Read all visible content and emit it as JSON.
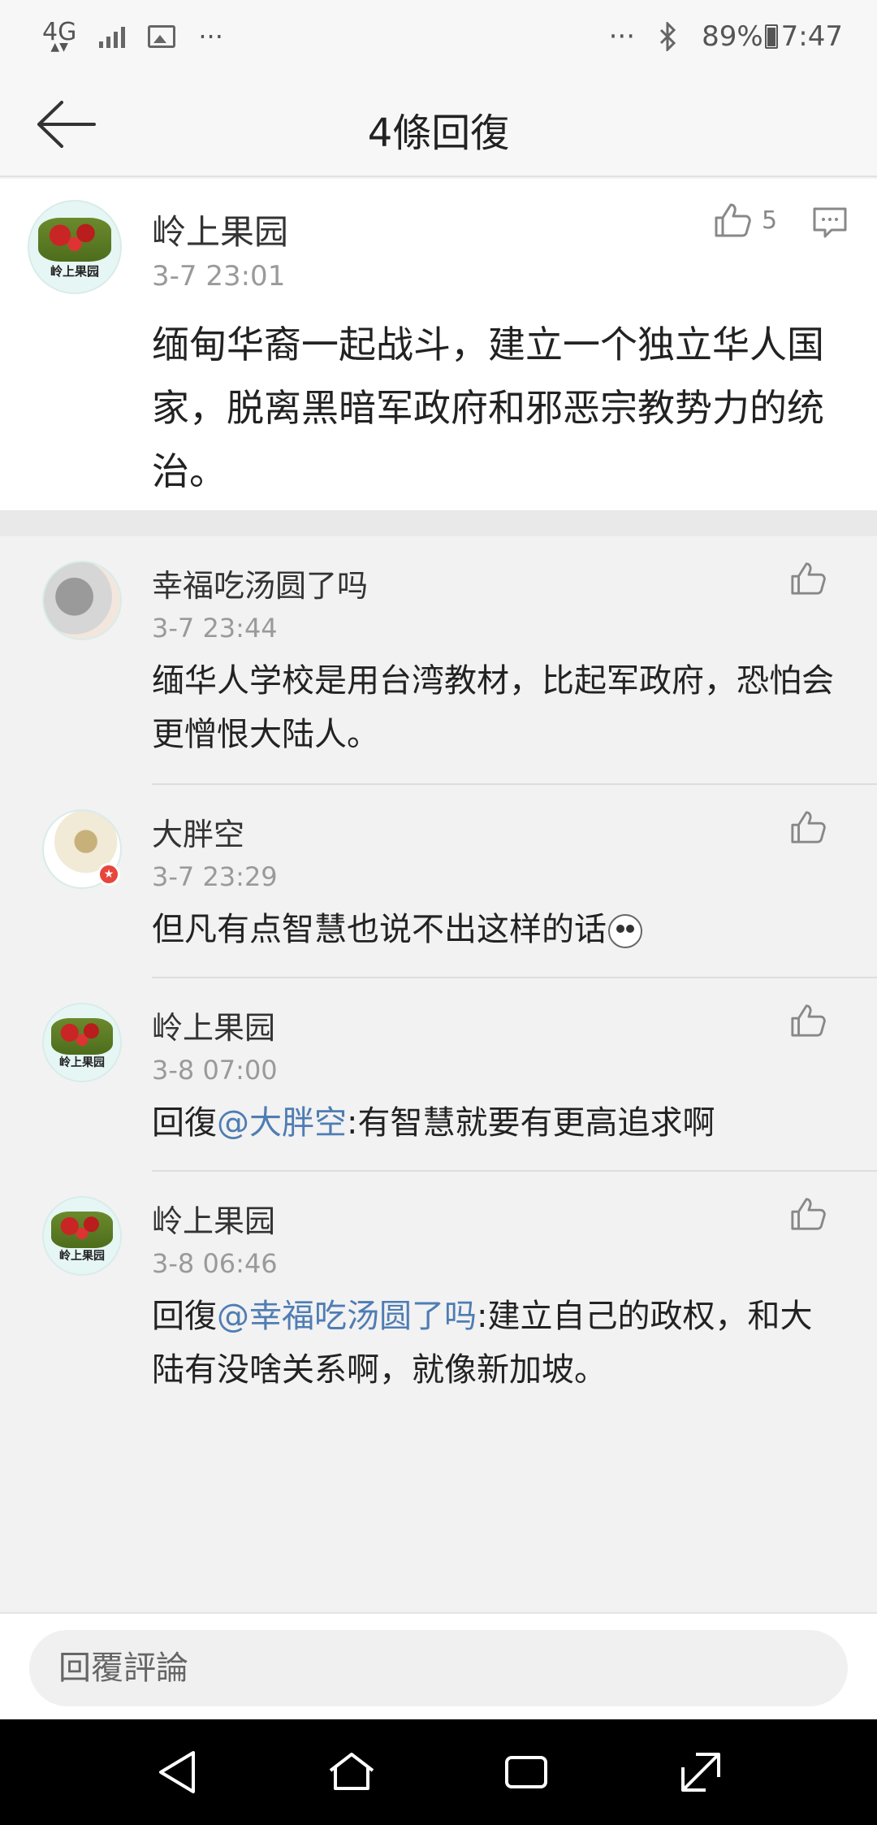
{
  "status_bar": {
    "network": "4G",
    "more": "···",
    "more_right": "···",
    "battery": "89%",
    "time": "7:47"
  },
  "header": {
    "title": "4條回復"
  },
  "main_comment": {
    "user": "岭上果园",
    "avatar_caption": "岭上果园",
    "time": "3-7 23:01",
    "like_count": "5",
    "text": "缅甸华裔一起战斗，建立一个独立华人国家，脱离黑暗军政府和邪恶宗教势力的统治。"
  },
  "replies": [
    {
      "user": "幸福吃汤圆了吗",
      "time": "3-7 23:44",
      "text": "缅华人学校是用台湾教材，比起军政府，恐怕会更憎恨大陆人。"
    },
    {
      "user": "大胖空",
      "time": "3-7 23:29",
      "text": "但凡有点智慧也说不出这样的话"
    },
    {
      "user": "岭上果园",
      "avatar_caption": "岭上果园",
      "time": "3-8 07:00",
      "prefix": "回復",
      "mention": "@大胖空",
      "text": ":有智慧就要有更高追求啊"
    },
    {
      "user": "岭上果园",
      "avatar_caption": "岭上果园",
      "time": "3-8 06:46",
      "prefix": "回復",
      "mention": "@幸福吃汤圆了吗",
      "text": ":建立自己的政权，和大陆有没啥关系啊，就像新加坡。"
    }
  ],
  "reply_bar": {
    "placeholder": "回覆評論"
  },
  "colors": {
    "mention": "#4f7db3",
    "background": "#f2f2f2",
    "navbar": "#000000"
  },
  "icons": [
    "back-arrow-icon",
    "thumbs-up-icon",
    "comment-icon",
    "nav-back-icon",
    "nav-home-icon",
    "nav-recents-icon",
    "nav-expand-icon"
  ]
}
